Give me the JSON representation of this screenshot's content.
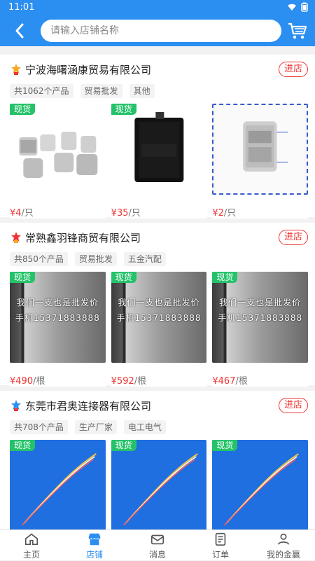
{
  "status": {
    "time": "11:01"
  },
  "search": {
    "placeholder": "请输入店铺名称"
  },
  "shops": [
    {
      "name": "宁波海曙涵康贸易有限公司",
      "enter_label": "进店",
      "tags": [
        "共1062个产品",
        "贸易批发",
        "其他"
      ],
      "products": [
        {
          "stock": "现货",
          "price": "¥4",
          "unit": "/只"
        },
        {
          "stock": "现货",
          "price": "¥35",
          "unit": "/只"
        },
        {
          "stock": "",
          "price": "¥2",
          "unit": "/只"
        }
      ]
    },
    {
      "name": "常熟鑫羽锋商贸有限公司",
      "enter_label": "进店",
      "tags": [
        "共850个产品",
        "贸易批发",
        "五金汽配"
      ],
      "products": [
        {
          "stock": "现货",
          "price": "¥490",
          "unit": "/根"
        },
        {
          "stock": "现货",
          "price": "¥592",
          "unit": "/根"
        },
        {
          "stock": "现货",
          "price": "¥467",
          "unit": "/根"
        }
      ],
      "ad_line_1": "我们一支也是批发价",
      "ad_line_2": "手机15371883888"
    },
    {
      "name": "东莞市君奥连接器有限公司",
      "enter_label": "进店",
      "tags": [
        "共708个产品",
        "生产厂家",
        "电工电气"
      ],
      "products": [
        {
          "stock": "现货",
          "price": "",
          "unit": ""
        },
        {
          "stock": "现货",
          "price": "",
          "unit": ""
        },
        {
          "stock": "现货",
          "price": "",
          "unit": ""
        }
      ]
    }
  ],
  "nav": [
    {
      "label": "主页",
      "icon": "home-icon"
    },
    {
      "label": "店铺",
      "icon": "store-icon"
    },
    {
      "label": "消息",
      "icon": "message-icon"
    },
    {
      "label": "订单",
      "icon": "order-icon"
    },
    {
      "label": "我的金赢",
      "icon": "user-icon"
    }
  ],
  "colors": {
    "primary": "#2b8ef1",
    "accent": "#e33",
    "stock": "#25c26a"
  }
}
